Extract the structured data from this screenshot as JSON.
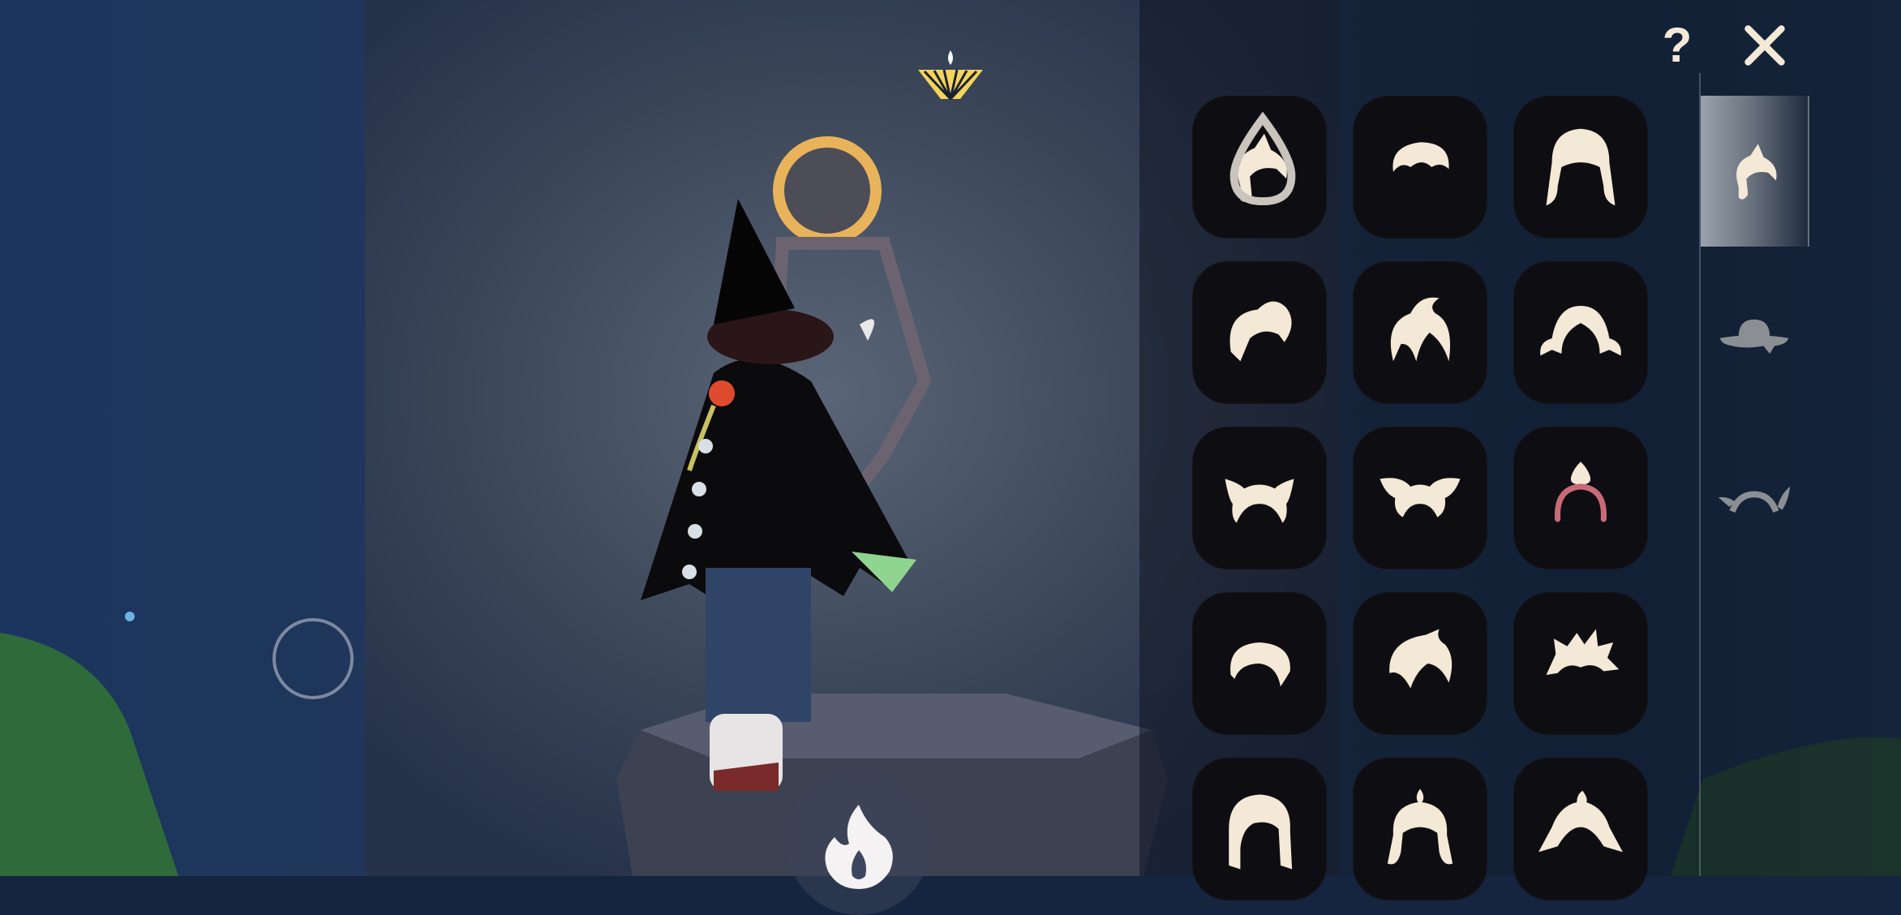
{
  "hud": {
    "help_label": "?",
    "help_icon": "question-icon",
    "close_icon": "close-icon",
    "candle_meter_icon": "candle-wing-fan-icon",
    "flame_icon": "flame-icon",
    "joystick_icon": "joystick-ring-icon"
  },
  "colors": {
    "accent_gold": "#f5d45a",
    "icon_cream": "#f4e9d6",
    "tile_bg": "#0e0d12",
    "tab_active": "#8a929c"
  },
  "category_tabs": [
    {
      "name": "hair",
      "icon": "hair-tab-icon",
      "active": true
    },
    {
      "name": "hat",
      "icon": "hat-tab-icon",
      "active": false
    },
    {
      "name": "horns",
      "icon": "horns-tab-icon",
      "active": false
    }
  ],
  "hair_options": [
    {
      "icon": "hair-braid-icon",
      "badge": "drop-icon",
      "selected": true
    },
    {
      "icon": "hair-short-icon"
    },
    {
      "icon": "hair-pigtails-icon"
    },
    {
      "icon": "hair-ponytail-icon"
    },
    {
      "icon": "hair-topknot-icon"
    },
    {
      "icon": "hair-side-tails-icon"
    },
    {
      "icon": "hair-buns-icon"
    },
    {
      "icon": "hair-bow-buns-icon"
    },
    {
      "icon": "hair-headband-icon"
    },
    {
      "icon": "hair-bob-icon"
    },
    {
      "icon": "hair-swept-icon"
    },
    {
      "icon": "hair-spiky-icon"
    },
    {
      "icon": "hair-long-icon"
    },
    {
      "icon": "hair-braids-icon"
    },
    {
      "icon": "hair-flared-icon"
    }
  ]
}
